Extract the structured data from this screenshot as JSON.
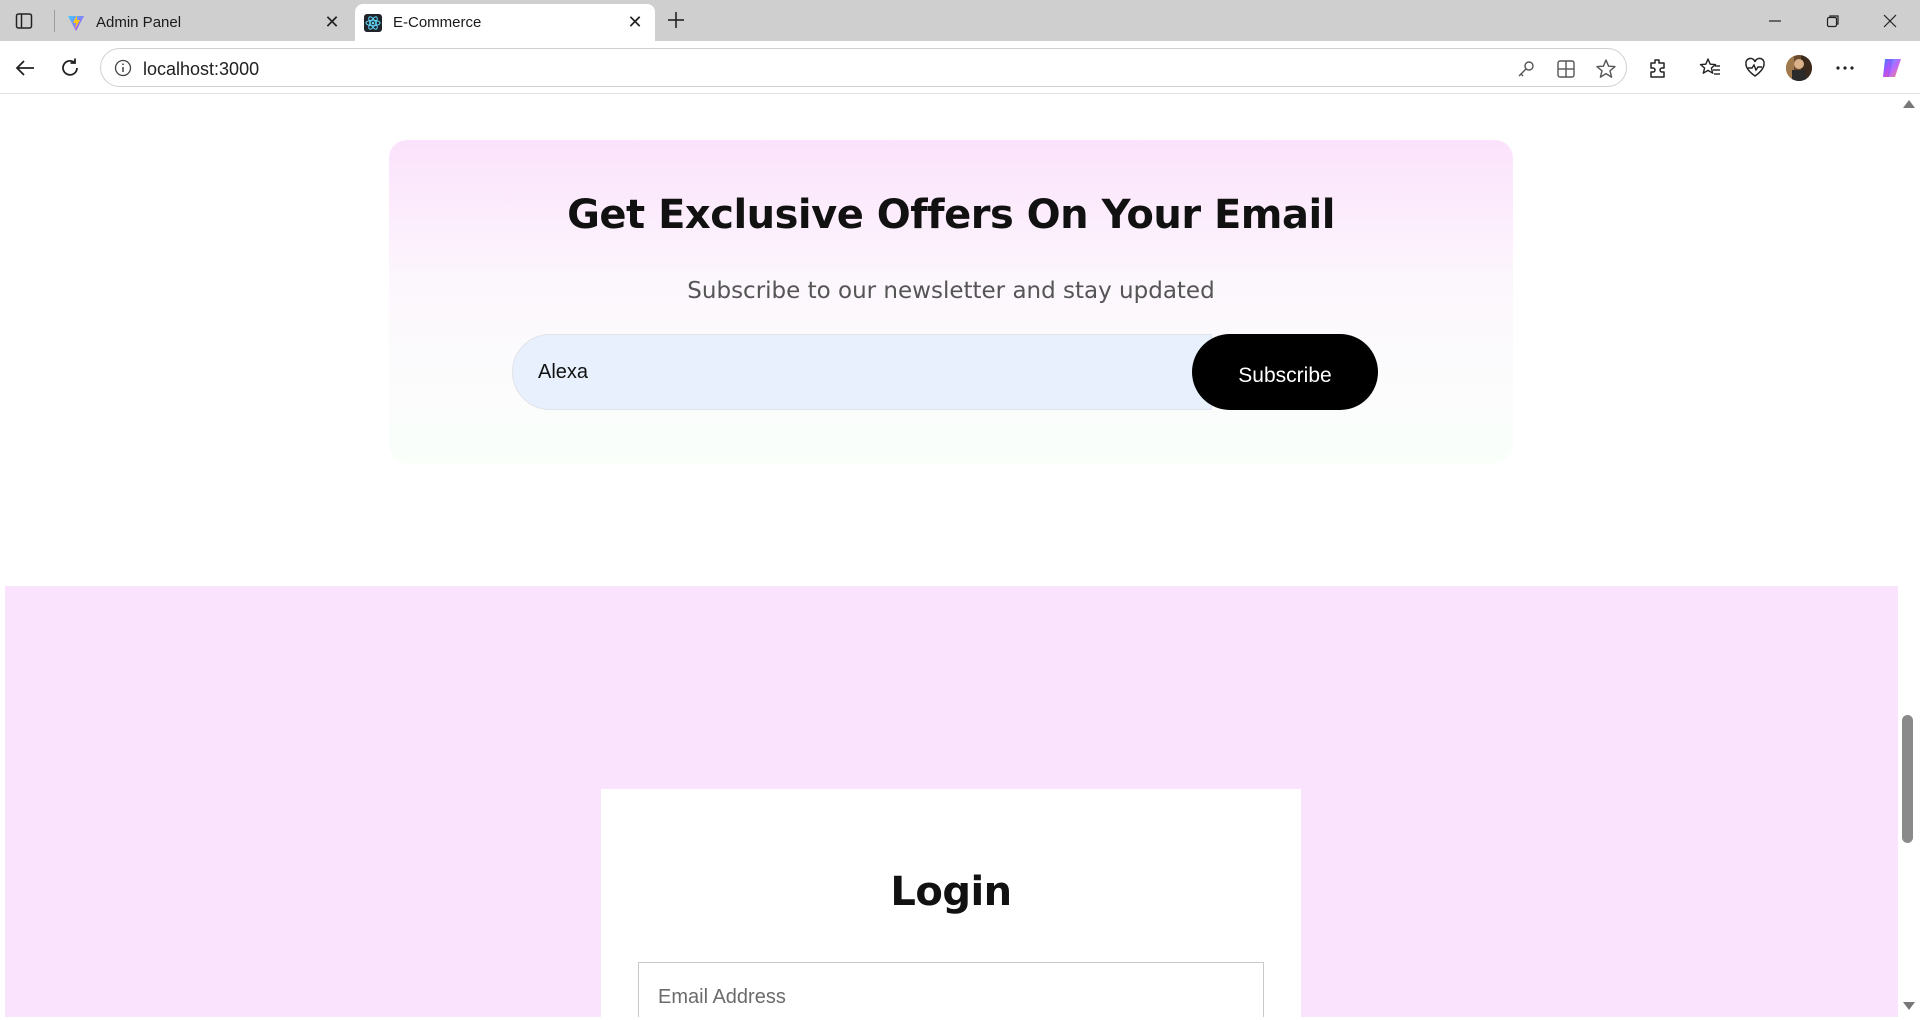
{
  "browser": {
    "tabs": [
      {
        "title": "Admin Panel",
        "active": false,
        "favicon": "vite-logo-icon"
      },
      {
        "title": "E-Commerce",
        "active": true,
        "favicon": "react-logo-icon"
      }
    ],
    "address": "localhost:3000",
    "colors": {
      "tabbar": "#cfcfcf",
      "toolbar": "#ffffff"
    }
  },
  "newsletter": {
    "title": "Get Exclusive Offers On Your Email",
    "subtitle": "Subscribe to our newsletter and stay updated",
    "email_value": "Alexa",
    "subscribe_label": "Subscribe",
    "colors": {
      "gradient_top": "#fbe2fc",
      "button": "#000000",
      "input_bg": "#e8f0fe"
    }
  },
  "login": {
    "title": "Login",
    "email_placeholder": "Email Address",
    "colors": {
      "section_bg": "#fae3fd",
      "card_bg": "#ffffff"
    }
  }
}
